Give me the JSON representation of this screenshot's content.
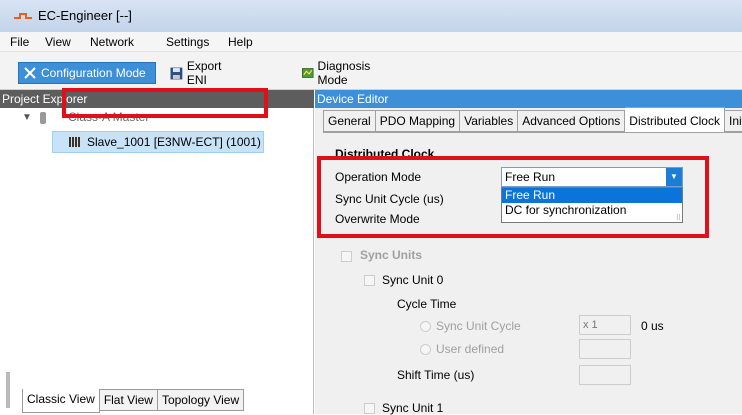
{
  "window": {
    "title": "EC-Engineer [--]"
  },
  "menu": [
    "File",
    "View",
    "Network",
    "Settings",
    "Help"
  ],
  "toolbar": {
    "config_mode": "Configuration Mode",
    "export_eni": "Export ENI",
    "diagnosis_mode": "Diagnosis Mode"
  },
  "project_explorer": {
    "title": "Project Explorer",
    "master": "Class-A Master",
    "slave": "Slave_1001 [E3NW-ECT] (1001)",
    "tabs": [
      "Classic View",
      "Flat View",
      "Topology View"
    ]
  },
  "device_editor": {
    "title": "Device Editor",
    "tabs": [
      "General",
      "PDO Mapping",
      "Variables",
      "Advanced Options",
      "Distributed Clock",
      "Init"
    ],
    "active_tab": "Distributed Clock",
    "dc": {
      "section_title": "Distributed Clock",
      "operation_mode_label": "Operation Mode",
      "operation_mode_value": "Free Run",
      "options": [
        "Free Run",
        "DC for synchronization"
      ],
      "sync_unit_cycle_label": "Sync Unit Cycle (us)",
      "overwrite_mode_label": "Overwrite Mode",
      "sync_units_label": "Sync Units",
      "sync_unit_0": "Sync Unit 0",
      "cycle_time": "Cycle Time",
      "sync_unit_cycle_radio": "Sync Unit Cycle",
      "multiplier": "x 1",
      "cycle_value": "0 us",
      "user_defined": "User defined",
      "shift_time": "Shift Time (us)",
      "sync_unit_1": "Sync Unit 1"
    }
  },
  "colors": {
    "highlight_box": "#e0101a",
    "accent": "#1b7dd6",
    "tree_selection": "#c7e3f8"
  }
}
